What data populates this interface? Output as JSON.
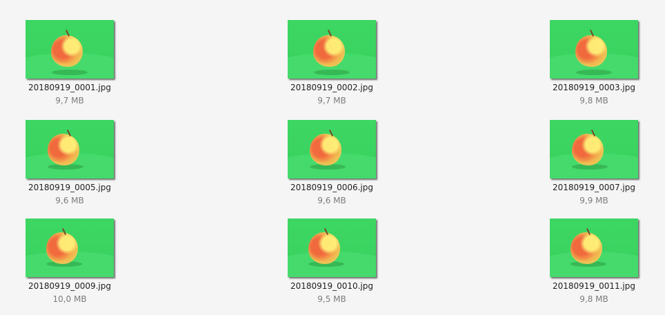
{
  "files": [
    {
      "name": "20180919_0001.jpg",
      "size": "9,7 MB"
    },
    {
      "name": "20180919_0002.jpg",
      "size": "9,7 MB"
    },
    {
      "name": "20180919_0003.jpg",
      "size": "9,8 MB"
    },
    {
      "name": "20180919_0005.jpg",
      "size": "9,6 MB"
    },
    {
      "name": "20180919_0006.jpg",
      "size": "9,6 MB"
    },
    {
      "name": "20180919_0007.jpg",
      "size": "9,9 MB"
    },
    {
      "name": "20180919_0009.jpg",
      "size": "10,0 MB"
    },
    {
      "name": "20180919_0010.jpg",
      "size": "9,5 MB"
    },
    {
      "name": "20180919_0011.jpg",
      "size": "9,8 MB"
    }
  ],
  "colors": {
    "background": "#f5f5f5",
    "thumbnail_backdrop": "#3dd663",
    "filename_text": "#1e1e1e",
    "size_text": "#7b7b7b"
  },
  "icons": {
    "thumbnail": "apple-photo-thumbnail"
  }
}
